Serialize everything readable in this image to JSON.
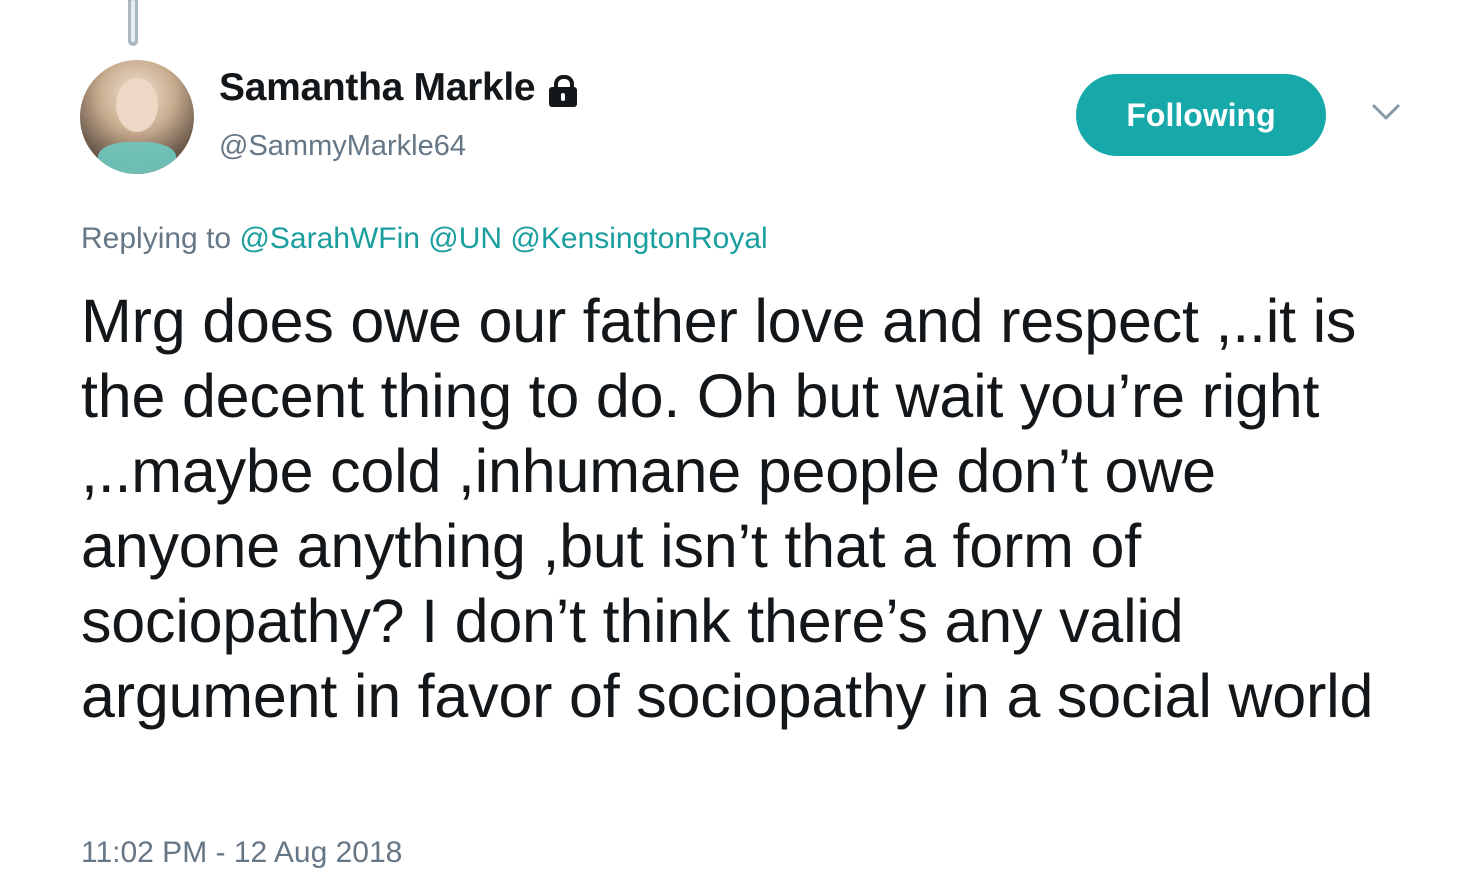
{
  "tweet": {
    "author": {
      "display_name": "Samantha Markle",
      "handle": "@SammyMarkle64",
      "protected_icon": "lock-icon",
      "avatar": "profile-photo"
    },
    "follow_button_label": "Following",
    "menu_icon": "chevron-down-icon",
    "replying_to": {
      "prefix": "Replying to",
      "mentions": [
        "@SarahWFin",
        "@UN",
        "@KensingtonRoyal"
      ]
    },
    "text": "Mrg does owe our father love and respect ,..it is the decent thing to do. Oh but wait you’re right ,..maybe cold ,inhumane people don’t owe anyone anything ,but isn’t that a form of sociopathy? I don’t think there’s any valid argument in favor of sociopathy in a social world",
    "timestamp": "11:02 PM - 12 Aug 2018"
  },
  "colors": {
    "accent": "#17a9a9",
    "mention": "#1b9e9e",
    "secondary_text": "#657786",
    "primary_text": "#14171a"
  }
}
